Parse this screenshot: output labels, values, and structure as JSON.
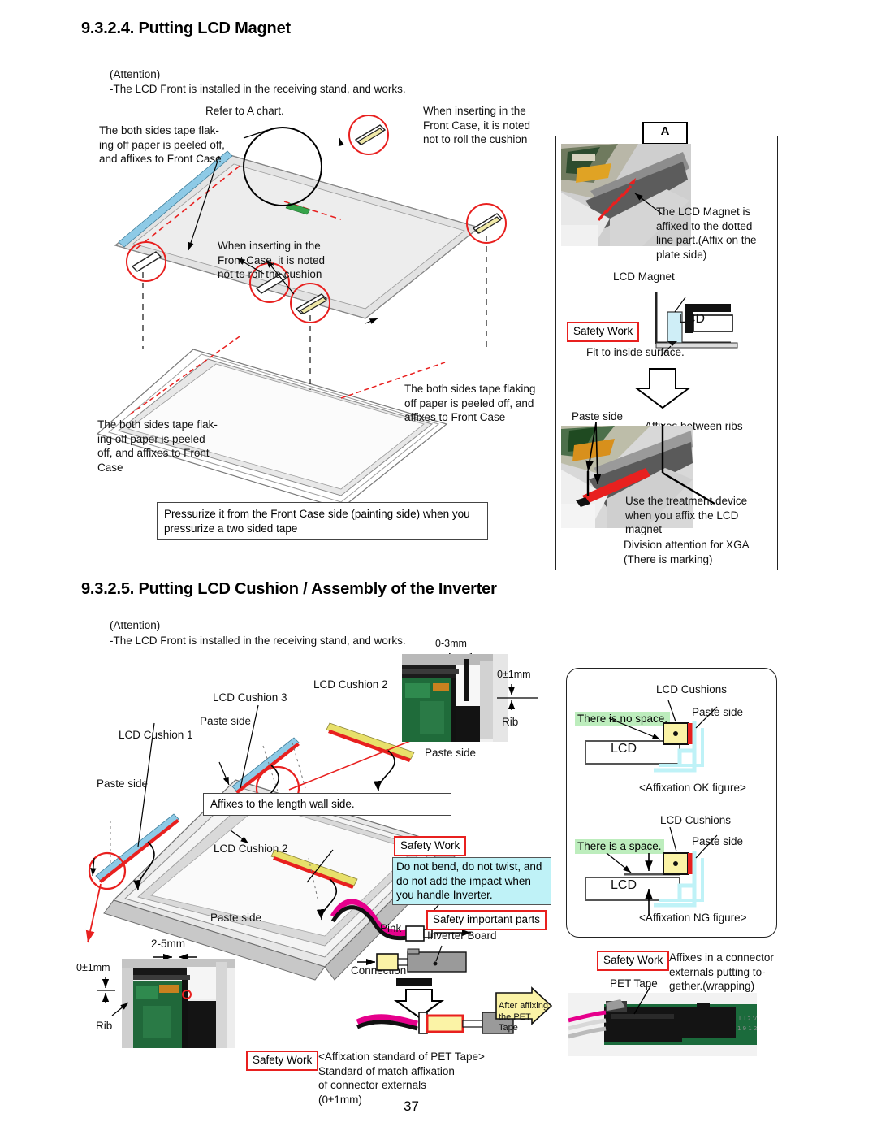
{
  "page": {
    "number": "37"
  },
  "section_924": {
    "heading": "9.3.2.4. Putting LCD Magnet",
    "attention_label": "(Attention)",
    "attention_text": "-The LCD Front is installed in the receiving stand, and works.",
    "callouts": {
      "refer_a_chart": "Refer to A chart.",
      "tape_left_top": "The both sides tape flak-\ning off paper is peeled off,\nand affixes to Front Case",
      "cushion_top_right": "When inserting in the\nFront Case, it is noted\nnot to roll the cushion",
      "cushion_middle": "When inserting in the\nFront Case, it is noted\nnot to roll the cushion",
      "tape_right": "The both sides tape flaking\noff paper is peeled off, and\naffixes to Front Case",
      "tape_bottom_left": "The both sides tape flak-\ning off paper is peeled\noff, and affixes to Front\nCase"
    },
    "note_box": "Pressurize it from the Front Case side (painting side) when you\npressurize a two sided tape",
    "panel_a": {
      "tag": "A",
      "photo_note": "The LCD Magnet is\naffixed to the dotted\nline part.(Affix on the\nplate side)",
      "magnet_label": "LCD Magnet",
      "lcd_label": "LCD",
      "safety_work": "Safety Work",
      "fit_note": "Fit to inside surface.",
      "paste_side": "Paste side",
      "affixes_ribs": "Affixes between ribs",
      "treatment_note": "Use the treatment device\nwhen you affix the LCD\nmagnet",
      "xga_note": "Division attention for XGA\n(There is marking)"
    }
  },
  "section_925": {
    "heading": "9.3.2.5. Putting LCD Cushion / Assembly of the Inverter",
    "attention_label": "(Attention)",
    "attention_text": "-The LCD Front is installed in the receiving stand, and works.",
    "callouts": {
      "cushion1": "LCD Cushion 1",
      "cushion2_top": "LCD Cushion 2",
      "cushion3": "LCD Cushion 3",
      "cushion2_mid": "LCD Cushion 2",
      "paste_side_1": "Paste side",
      "paste_side_2": "Paste side",
      "paste_side_3": "Paste side",
      "paste_side_4": "Paste side",
      "paste_side_5": "Paste side",
      "affixes_wall": "Affixes to the length wall side.",
      "pink": "Pink",
      "connection": "Connection",
      "inverter_board": "Inverter Board",
      "dim_0_3mm": "0-3mm",
      "dim_0_1mm_top": "0±1mm",
      "dim_0_1mm_left": "0±1mm",
      "dim_2_5mm": "2-5mm",
      "rib_top": "Rib",
      "rib_left": "Rib"
    },
    "safety_work_inverter": "Safety Work",
    "inverter_warning": "Do not bend, do not twist, and\ndo not add the impact when\nyou handle Inverter.",
    "safety_important_parts": "Safety important parts",
    "affixation_panel": {
      "ok": {
        "cushions_label": "LCD Cushions",
        "paste_side": "Paste side",
        "space_note": "There is no space.",
        "lcd_label": "LCD",
        "caption": "<Affixation OK figure>"
      },
      "ng": {
        "cushions_label": "LCD Cushions",
        "paste_side": "Paste side",
        "space_note": "There is a space.",
        "lcd_label": "LCD",
        "caption": "<Affixation NG figure>"
      }
    },
    "pet_tape_block": {
      "safety_work": "Safety Work",
      "pet_tape_label": "PET  Tape",
      "note": "Affixes in a connector\nexternals putting to-\ngether.(wrapping)",
      "arrow_note": "After affixing\nthe PET Tape"
    },
    "pet_standard_block": {
      "safety_work": "Safety Work",
      "text": "<Affixation standard of PET Tape>\n Standard of match affixation\n of connector externals\n (0±1mm)"
    }
  },
  "colors": {
    "red": "#e8201f",
    "cyan": "#bff2f7",
    "green": "#bdedbd",
    "yellow": "#fbf3a6",
    "magenta": "#e6008c",
    "tape_blue": "#8ecae6",
    "tape_yellow": "#e8e06a"
  }
}
